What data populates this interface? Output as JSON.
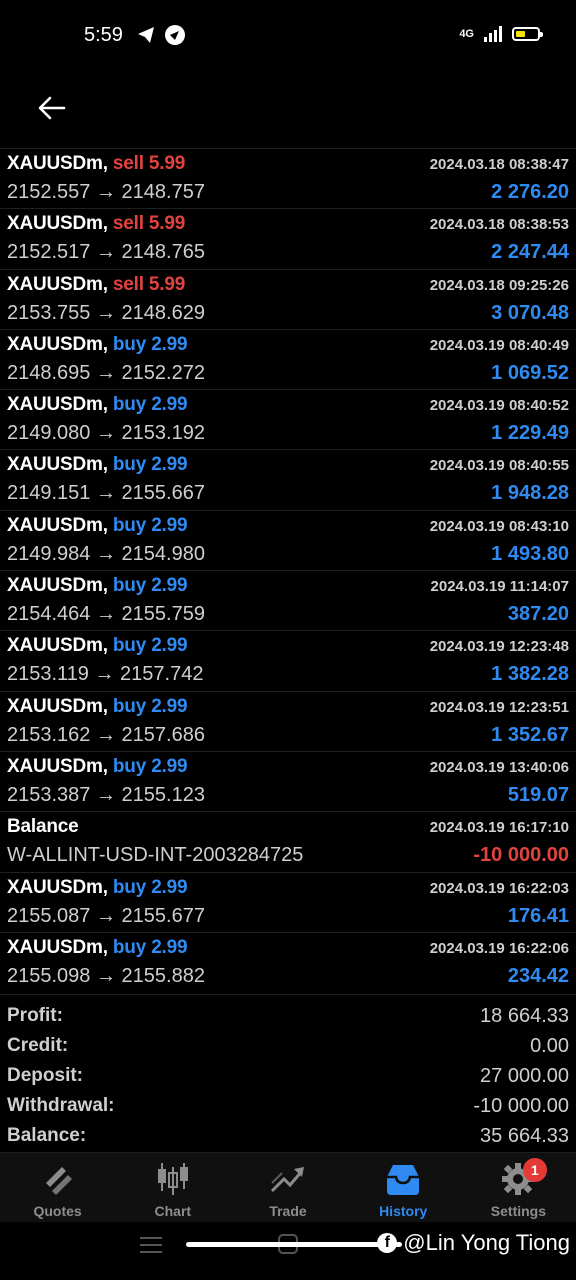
{
  "status_bar": {
    "time": "5:59",
    "network": "4G"
  },
  "trades": [
    {
      "symbol": "XAUUSDm,",
      "side": "sell",
      "volume": "5.99",
      "prices": "2152.557 → 2148.757",
      "datetime": "2024.03.18 08:38:47",
      "profit": "2 276.20"
    },
    {
      "symbol": "XAUUSDm,",
      "side": "sell",
      "volume": "5.99",
      "prices": "2152.517 → 2148.765",
      "datetime": "2024.03.18 08:38:53",
      "profit": "2 247.44"
    },
    {
      "symbol": "XAUUSDm,",
      "side": "sell",
      "volume": "5.99",
      "prices": "2153.755 → 2148.629",
      "datetime": "2024.03.18 09:25:26",
      "profit": "3 070.48"
    },
    {
      "symbol": "XAUUSDm,",
      "side": "buy",
      "volume": "2.99",
      "prices": "2148.695 → 2152.272",
      "datetime": "2024.03.19 08:40:49",
      "profit": "1 069.52"
    },
    {
      "symbol": "XAUUSDm,",
      "side": "buy",
      "volume": "2.99",
      "prices": "2149.080 → 2153.192",
      "datetime": "2024.03.19 08:40:52",
      "profit": "1 229.49"
    },
    {
      "symbol": "XAUUSDm,",
      "side": "buy",
      "volume": "2.99",
      "prices": "2149.151 → 2155.667",
      "datetime": "2024.03.19 08:40:55",
      "profit": "1 948.28"
    },
    {
      "symbol": "XAUUSDm,",
      "side": "buy",
      "volume": "2.99",
      "prices": "2149.984 → 2154.980",
      "datetime": "2024.03.19 08:43:10",
      "profit": "1 493.80"
    },
    {
      "symbol": "XAUUSDm,",
      "side": "buy",
      "volume": "2.99",
      "prices": "2154.464 → 2155.759",
      "datetime": "2024.03.19 11:14:07",
      "profit": "387.20"
    },
    {
      "symbol": "XAUUSDm,",
      "side": "buy",
      "volume": "2.99",
      "prices": "2153.119 → 2157.742",
      "datetime": "2024.03.19 12:23:48",
      "profit": "1 382.28"
    },
    {
      "symbol": "XAUUSDm,",
      "side": "buy",
      "volume": "2.99",
      "prices": "2153.162 → 2157.686",
      "datetime": "2024.03.19 12:23:51",
      "profit": "1 352.67"
    },
    {
      "symbol": "XAUUSDm,",
      "side": "buy",
      "volume": "2.99",
      "prices": "2153.387 → 2155.123",
      "datetime": "2024.03.19 13:40:06",
      "profit": "519.07"
    },
    {
      "symbol": "Balance",
      "side": "",
      "volume": "",
      "prices": "W-ALLINT-USD-INT-2003284725",
      "datetime": "2024.03.19 16:17:10",
      "profit": "-10 000.00"
    },
    {
      "symbol": "XAUUSDm,",
      "side": "buy",
      "volume": "2.99",
      "prices": "2155.087 → 2155.677",
      "datetime": "2024.03.19 16:22:03",
      "profit": "176.41"
    },
    {
      "symbol": "XAUUSDm,",
      "side": "buy",
      "volume": "2.99",
      "prices": "2155.098 → 2155.882",
      "datetime": "2024.03.19 16:22:06",
      "profit": "234.42"
    }
  ],
  "summary": [
    {
      "label": "Profit:",
      "value": "18 664.33"
    },
    {
      "label": "Credit:",
      "value": "0.00"
    },
    {
      "label": "Deposit:",
      "value": "27 000.00"
    },
    {
      "label": "Withdrawal:",
      "value": "-10 000.00"
    },
    {
      "label": "Balance:",
      "value": "35 664.33"
    }
  ],
  "nav": {
    "quotes": "Quotes",
    "chart": "Chart",
    "trade": "Trade",
    "history": "History",
    "settings": "Settings",
    "settings_badge": "1"
  },
  "watermark": "@Lin Yong Tiong",
  "colors": {
    "sell": "#e2433e",
    "buy": "#2f8bf2",
    "active": "#2f8bf2"
  }
}
